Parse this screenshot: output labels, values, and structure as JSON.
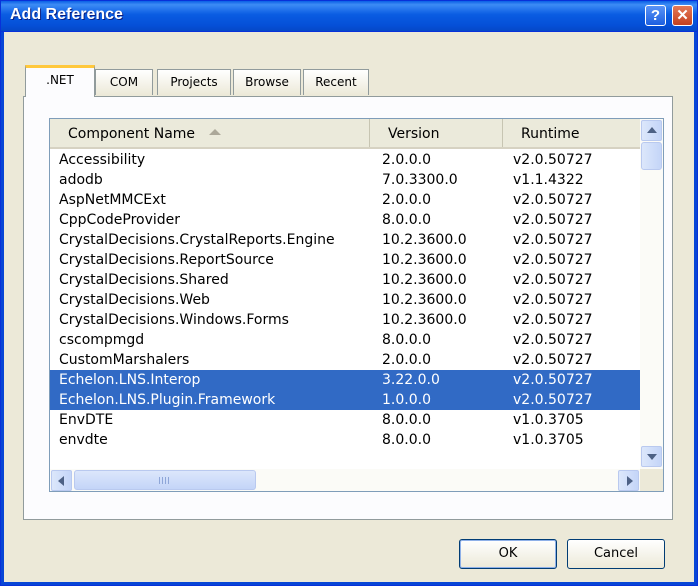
{
  "window": {
    "title": "Add Reference",
    "help_label": "?",
    "close_label": "✕"
  },
  "tabs": [
    ".NET",
    "COM",
    "Projects",
    "Browse",
    "Recent"
  ],
  "columns": {
    "name": "Component Name",
    "version": "Version",
    "runtime": "Runtime"
  },
  "rows": [
    {
      "name": "Accessibility",
      "version": "2.0.0.0",
      "runtime": "v2.0.50727",
      "selected": false
    },
    {
      "name": "adodb",
      "version": "7.0.3300.0",
      "runtime": "v1.1.4322",
      "selected": false
    },
    {
      "name": "AspNetMMCExt",
      "version": "2.0.0.0",
      "runtime": "v2.0.50727",
      "selected": false
    },
    {
      "name": "CppCodeProvider",
      "version": "8.0.0.0",
      "runtime": "v2.0.50727",
      "selected": false
    },
    {
      "name": "CrystalDecisions.CrystalReports.Engine",
      "version": "10.2.3600.0",
      "runtime": "v2.0.50727",
      "selected": false
    },
    {
      "name": "CrystalDecisions.ReportSource",
      "version": "10.2.3600.0",
      "runtime": "v2.0.50727",
      "selected": false
    },
    {
      "name": "CrystalDecisions.Shared",
      "version": "10.2.3600.0",
      "runtime": "v2.0.50727",
      "selected": false
    },
    {
      "name": "CrystalDecisions.Web",
      "version": "10.2.3600.0",
      "runtime": "v2.0.50727",
      "selected": false
    },
    {
      "name": "CrystalDecisions.Windows.Forms",
      "version": "10.2.3600.0",
      "runtime": "v2.0.50727",
      "selected": false
    },
    {
      "name": "cscompmgd",
      "version": "8.0.0.0",
      "runtime": "v2.0.50727",
      "selected": false
    },
    {
      "name": "CustomMarshalers",
      "version": "2.0.0.0",
      "runtime": "v2.0.50727",
      "selected": false
    },
    {
      "name": "Echelon.LNS.Interop",
      "version": "3.22.0.0",
      "runtime": "v2.0.50727",
      "selected": true
    },
    {
      "name": "Echelon.LNS.Plugin.Framework",
      "version": "1.0.0.0",
      "runtime": "v2.0.50727",
      "selected": true
    },
    {
      "name": "EnvDTE",
      "version": "8.0.0.0",
      "runtime": "v1.0.3705",
      "selected": false
    },
    {
      "name": "envdte",
      "version": "8.0.0.0",
      "runtime": "v1.0.3705",
      "selected": false
    }
  ],
  "buttons": {
    "ok": "OK",
    "cancel": "Cancel"
  },
  "colors": {
    "selection": "#316ac5",
    "title_bar": "#0a5ce2",
    "dialog_face": "#ece9d8"
  }
}
